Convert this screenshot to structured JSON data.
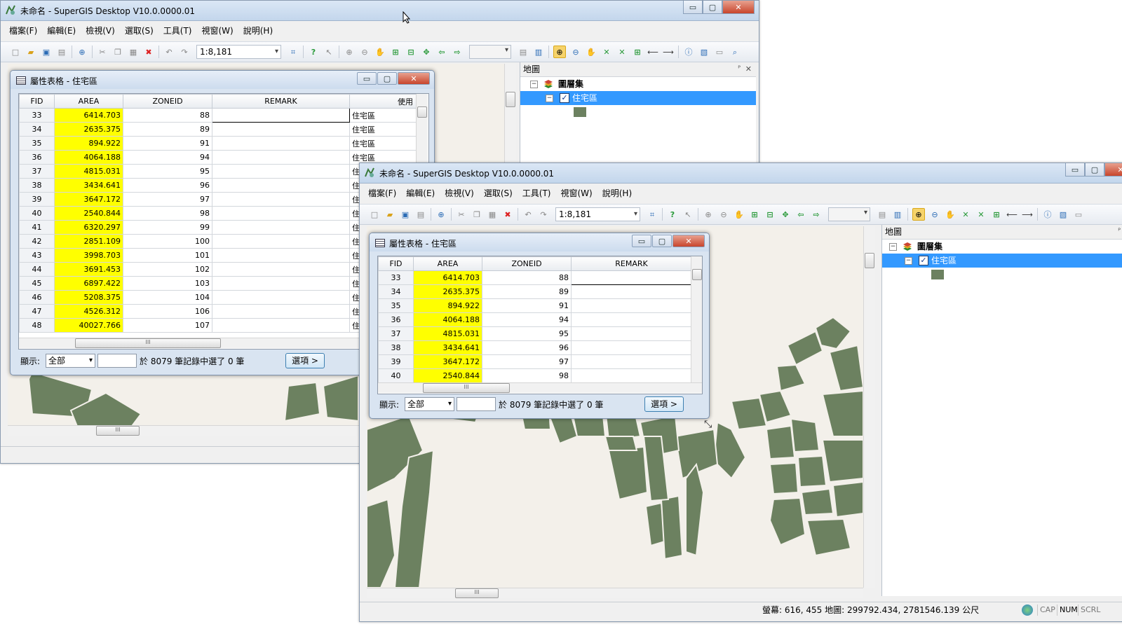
{
  "app": {
    "title": "未命名 - SuperGIS Desktop V10.0.0000.01",
    "menu": [
      "檔案(F)",
      "編輯(E)",
      "檢視(V)",
      "選取(S)",
      "工具(T)",
      "視窗(W)",
      "說明(H)"
    ],
    "scale": "1:8,181",
    "window_buttons": {
      "minimize": "▭",
      "maximize": "▢",
      "close": "✕"
    }
  },
  "map_panel": {
    "title": "地圖",
    "pin": "ᴾ",
    "close": "✕",
    "group": "圖層集",
    "layer": "住宅區",
    "layer_color": "#6c8160"
  },
  "attr_table": {
    "title": "屬性表格 - 住宅區",
    "columns": [
      "FID",
      "AREA",
      "ZONEID",
      "REMARK",
      "使用"
    ],
    "rows": [
      {
        "fid": "33",
        "area": "6414.703",
        "zoneid": "88",
        "use": "住宅區"
      },
      {
        "fid": "34",
        "area": "2635.375",
        "zoneid": "89",
        "use": "住宅區"
      },
      {
        "fid": "35",
        "area": "894.922",
        "zoneid": "91",
        "use": "住宅區"
      },
      {
        "fid": "36",
        "area": "4064.188",
        "zoneid": "94",
        "use": "住宅區"
      },
      {
        "fid": "37",
        "area": "4815.031",
        "zoneid": "95",
        "use": "住"
      },
      {
        "fid": "38",
        "area": "3434.641",
        "zoneid": "96",
        "use": "住"
      },
      {
        "fid": "39",
        "area": "3647.172",
        "zoneid": "97",
        "use": "住"
      },
      {
        "fid": "40",
        "area": "2540.844",
        "zoneid": "98",
        "use": "住"
      },
      {
        "fid": "41",
        "area": "6320.297",
        "zoneid": "99",
        "use": "住"
      },
      {
        "fid": "42",
        "area": "2851.109",
        "zoneid": "100",
        "use": "住"
      },
      {
        "fid": "43",
        "area": "3998.703",
        "zoneid": "101",
        "use": "住"
      },
      {
        "fid": "44",
        "area": "3691.453",
        "zoneid": "102",
        "use": "住"
      },
      {
        "fid": "45",
        "area": "6897.422",
        "zoneid": "103",
        "use": "住"
      },
      {
        "fid": "46",
        "area": "5208.375",
        "zoneid": "104",
        "use": "住"
      },
      {
        "fid": "47",
        "area": "4526.312",
        "zoneid": "106",
        "use": "住"
      },
      {
        "fid": "48",
        "area": "40027.766",
        "zoneid": "107",
        "use": "住"
      }
    ],
    "show_label": "顯示:",
    "show_value": "全部",
    "record_text": "於 8079 筆記錄中選了 0 筆",
    "options_button": "選項 >"
  },
  "status": {
    "coords": "螢幕: 616, 455  地圖: 299792.434, 2781546.139 公尺",
    "caps": "CAP",
    "num": "NUM",
    "scrl": "SCRL"
  }
}
